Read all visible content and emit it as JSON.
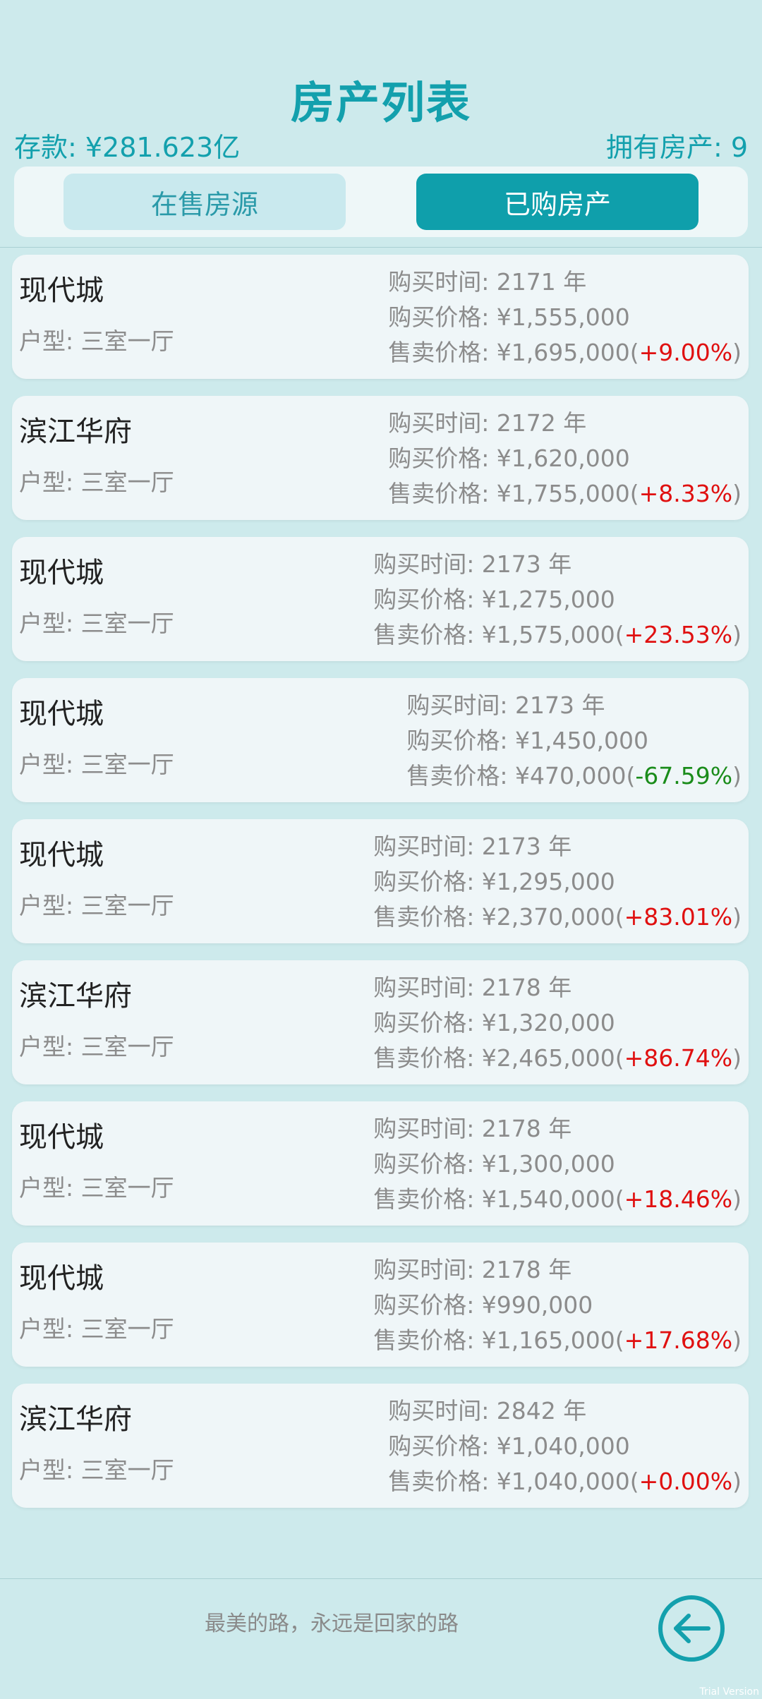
{
  "header": {
    "title": "房产列表",
    "savings": "存款: ¥281.623亿",
    "owned": "拥有房产: 9"
  },
  "tabs": {
    "for_sale": "在售房源",
    "purchased": "已购房产"
  },
  "properties": [
    {
      "name": "现代城",
      "type": "户型: 三室一厅",
      "time": "购买时间: 2171 年",
      "buy": "购买价格: ¥1,555,000",
      "sell": "售卖价格: ¥1,695,000(",
      "pct": "+9.00%",
      "close": ")"
    },
    {
      "name": "滨江华府",
      "type": "户型: 三室一厅",
      "time": "购买时间: 2172 年",
      "buy": "购买价格: ¥1,620,000",
      "sell": "售卖价格: ¥1,755,000(",
      "pct": "+8.33%",
      "close": ")"
    },
    {
      "name": "现代城",
      "type": "户型: 三室一厅",
      "time": "购买时间: 2173 年",
      "buy": "购买价格: ¥1,275,000",
      "sell": "售卖价格: ¥1,575,000(",
      "pct": "+23.53%",
      "close": ")"
    },
    {
      "name": "现代城",
      "type": "户型: 三室一厅",
      "time": "购买时间: 2173 年",
      "buy": "购买价格: ¥1,450,000",
      "sell": "售卖价格: ¥470,000(",
      "pct": "-67.59%",
      "close": ")"
    },
    {
      "name": "现代城",
      "type": "户型: 三室一厅",
      "time": "购买时间: 2173 年",
      "buy": "购买价格: ¥1,295,000",
      "sell": "售卖价格: ¥2,370,000(",
      "pct": "+83.01%",
      "close": ")"
    },
    {
      "name": "滨江华府",
      "type": "户型: 三室一厅",
      "time": "购买时间: 2178 年",
      "buy": "购买价格: ¥1,320,000",
      "sell": "售卖价格: ¥2,465,000(",
      "pct": "+86.74%",
      "close": ")"
    },
    {
      "name": "现代城",
      "type": "户型: 三室一厅",
      "time": "购买时间: 2178 年",
      "buy": "购买价格: ¥1,300,000",
      "sell": "售卖价格: ¥1,540,000(",
      "pct": "+18.46%",
      "close": ")"
    },
    {
      "name": "现代城",
      "type": "户型: 三室一厅",
      "time": "购买时间: 2178 年",
      "buy": "购买价格: ¥990,000",
      "sell": "售卖价格: ¥1,165,000(",
      "pct": "+17.68%",
      "close": ")"
    },
    {
      "name": "滨江华府",
      "type": "户型: 三室一厅",
      "time": "购买时间: 2842 年",
      "buy": "购买价格: ¥1,040,000",
      "sell": "售卖价格: ¥1,040,000(",
      "pct": "+0.00%",
      "close": ")"
    }
  ],
  "footer": {
    "slogan": "最美的路，永远是回家的路",
    "corner": "Trial Version"
  },
  "icons": {
    "back": "back-arrow-icon"
  },
  "colors": {
    "accent": "#13a0ad",
    "up": "#e01010",
    "down": "#1a8c1a",
    "background": "#cdeaec"
  }
}
